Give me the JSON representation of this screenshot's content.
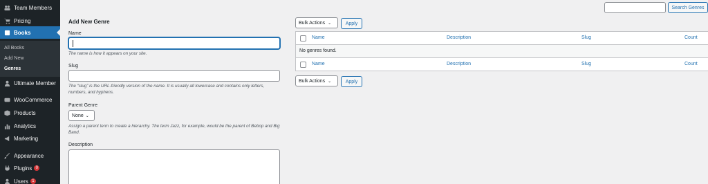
{
  "sidebar": {
    "items": [
      {
        "label": "Team Members",
        "icon": "groups-icon"
      },
      {
        "label": "Pricing",
        "icon": "cart-icon"
      },
      {
        "label": "Books",
        "icon": "book-icon",
        "active": true
      },
      {
        "label": "Ultimate Member",
        "icon": "user-icon"
      },
      {
        "label": "WooCommerce",
        "icon": "woo-icon"
      },
      {
        "label": "Products",
        "icon": "box-icon"
      },
      {
        "label": "Analytics",
        "icon": "chart-icon"
      },
      {
        "label": "Marketing",
        "icon": "megaphone-icon"
      },
      {
        "label": "Appearance",
        "icon": "brush-icon"
      },
      {
        "label": "Plugins",
        "icon": "plug-icon",
        "badge": "0"
      },
      {
        "label": "Users",
        "icon": "users-icon",
        "badge": "1"
      }
    ],
    "submenu": [
      "All Books",
      "Add New",
      "Genres"
    ]
  },
  "form": {
    "title": "Add New Genre",
    "name_label": "Name",
    "name_value": "",
    "name_help": "The name is how it appears on your site.",
    "slug_label": "Slug",
    "slug_value": "",
    "slug_help": "The “slug” is the URL-friendly version of the name. It is usually all lowercase and contains only letters, numbers, and hyphens.",
    "parent_label": "Parent Genre",
    "parent_value": "None",
    "parent_help": "Assign a parent term to create a hierarchy. The term Jazz, for example, would be the parent of Bebop and Big Band.",
    "description_label": "Description",
    "description_value": ""
  },
  "list": {
    "search_value": "",
    "search_button": "Search Genres",
    "bulk_label": "Bulk Actions",
    "apply_label": "Apply",
    "columns": [
      "Name",
      "Description",
      "Slug",
      "Count"
    ],
    "empty_message": "No genres found."
  },
  "colors": {
    "sidebar_bg": "#1d2327",
    "accent": "#2271b1",
    "badge": "#d63638",
    "page_bg": "#f0f0f1"
  }
}
